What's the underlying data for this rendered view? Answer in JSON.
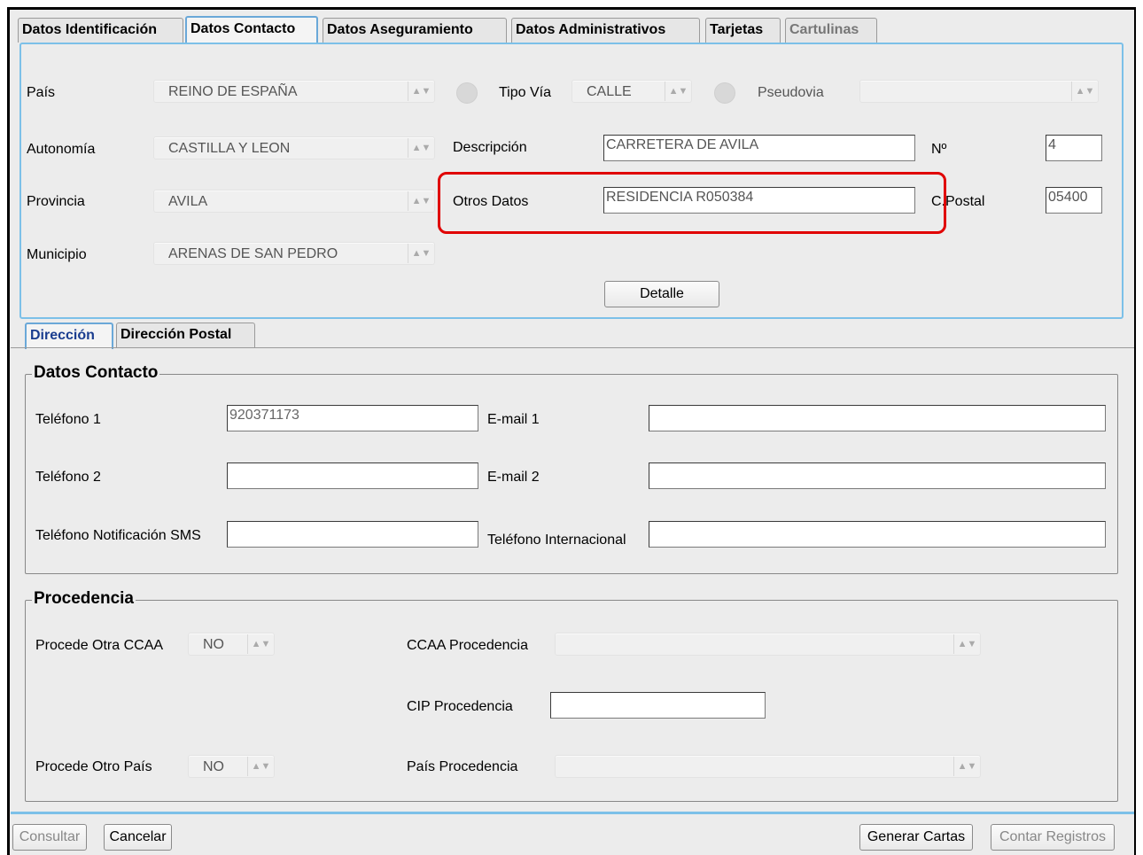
{
  "tabs": [
    {
      "label": "Datos Identificación",
      "active": false,
      "enabled": true
    },
    {
      "label": "Datos Contacto",
      "active": true,
      "enabled": true
    },
    {
      "label": "Datos Aseguramiento",
      "active": false,
      "enabled": true
    },
    {
      "label": "Datos Administrativos",
      "active": false,
      "enabled": true
    },
    {
      "label": "Tarjetas",
      "active": false,
      "enabled": true
    },
    {
      "label": "Cartulinas",
      "active": false,
      "enabled": false
    }
  ],
  "address": {
    "pais": {
      "label": "País",
      "value": "REINO DE ESPAÑA"
    },
    "tipo_via": {
      "label": "Tipo Vía",
      "value": "CALLE"
    },
    "pseudovia": {
      "label": "Pseudovia",
      "value": ""
    },
    "autonomia": {
      "label": "Autonomía",
      "value": "CASTILLA Y LEON"
    },
    "descripcion": {
      "label": "Descripción",
      "value": "CARRETERA DE AVILA"
    },
    "numero": {
      "label": "Nº",
      "value": "4"
    },
    "provincia": {
      "label": "Provincia",
      "value": "AVILA"
    },
    "otros_datos": {
      "label": "Otros Datos",
      "value": "RESIDENCIA R050384"
    },
    "cpostal": {
      "label": "C.Postal",
      "value": "05400"
    },
    "municipio": {
      "label": "Municipio",
      "value": "ARENAS DE SAN PEDRO"
    },
    "detalle_button": "Detalle"
  },
  "subtabs": [
    {
      "label": "Dirección",
      "active": true
    },
    {
      "label": "Dirección Postal",
      "active": false
    }
  ],
  "contacto": {
    "title": "Datos Contacto",
    "telefono1": {
      "label": "Teléfono 1",
      "value": "920371173"
    },
    "telefono2": {
      "label": "Teléfono 2",
      "value": ""
    },
    "telefono_sms": {
      "label": "Teléfono Notificación SMS",
      "value": ""
    },
    "email1": {
      "label": "E-mail 1",
      "value": ""
    },
    "email2": {
      "label": "E-mail 2",
      "value": ""
    },
    "telefono_internacional": {
      "label": "Teléfono Internacional",
      "value": ""
    }
  },
  "procedencia": {
    "title": "Procedencia",
    "otra_ccaa": {
      "label": "Procede Otra CCAA",
      "value": "NO"
    },
    "ccaa_procedencia": {
      "label": "CCAA Procedencia",
      "value": ""
    },
    "cip_procedencia": {
      "label": "CIP Procedencia",
      "value": ""
    },
    "otro_pais": {
      "label": "Procede Otro País",
      "value": "NO"
    },
    "pais_procedencia": {
      "label": "País Procedencia",
      "value": ""
    }
  },
  "footer": {
    "consultar": "Consultar",
    "cancelar": "Cancelar",
    "generar_cartas": "Generar Cartas",
    "contar_registros": "Contar Registros"
  },
  "colors": {
    "highlight": "#e00000",
    "panel_border": "#7cc0e8",
    "active_subtab_text": "#1a3d8f"
  }
}
